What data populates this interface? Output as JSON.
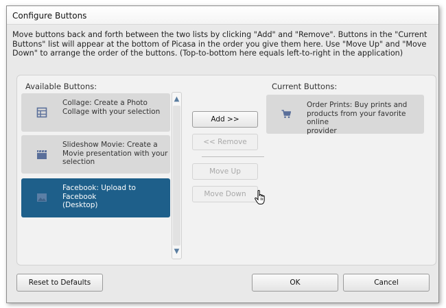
{
  "window": {
    "title": "Configure Buttons"
  },
  "intro_lines": [
    "Move buttons back and forth between the two lists by clicking \"Add\" and \"Remove\".  Buttons in the \"Current",
    "Buttons\" list will appear at the bottom of Picasa in the order you give them here.  Use \"Move Up\" and \"Move",
    "Down\" to arrange the order of the buttons.  (Top-to-bottom here equals left-to-right in the application)"
  ],
  "available": {
    "title": "Available Buttons:",
    "items": [
      {
        "icon": "collage-icon",
        "lines": [
          "Collage:  Create a Photo",
          "Collage with your selection"
        ],
        "selected": false
      },
      {
        "icon": "clapperboard-icon",
        "lines": [
          "Slideshow Movie:  Create a",
          "Movie presentation with your",
          "selection"
        ],
        "selected": false
      },
      {
        "icon": "picture-icon",
        "lines": [
          "Facebook:  Upload to Facebook",
          "(Desktop)"
        ],
        "selected": true
      }
    ]
  },
  "current": {
    "title": "Current Buttons:",
    "items": [
      {
        "icon": "shopping-cart-icon",
        "lines": [
          "Order Prints:  Buy prints and",
          "products from your favorite online",
          "provider"
        ]
      }
    ]
  },
  "actions": {
    "add": "Add >>",
    "remove": "<< Remove",
    "move_up": "Move Up",
    "move_down": "Move Down"
  },
  "footer": {
    "reset": "Reset to Defaults",
    "ok": "OK",
    "cancel": "Cancel"
  },
  "colors": {
    "selected_item": "#1e5f8a",
    "item_background": "#d9d9d9",
    "icon_color": "#5a6f9a"
  }
}
